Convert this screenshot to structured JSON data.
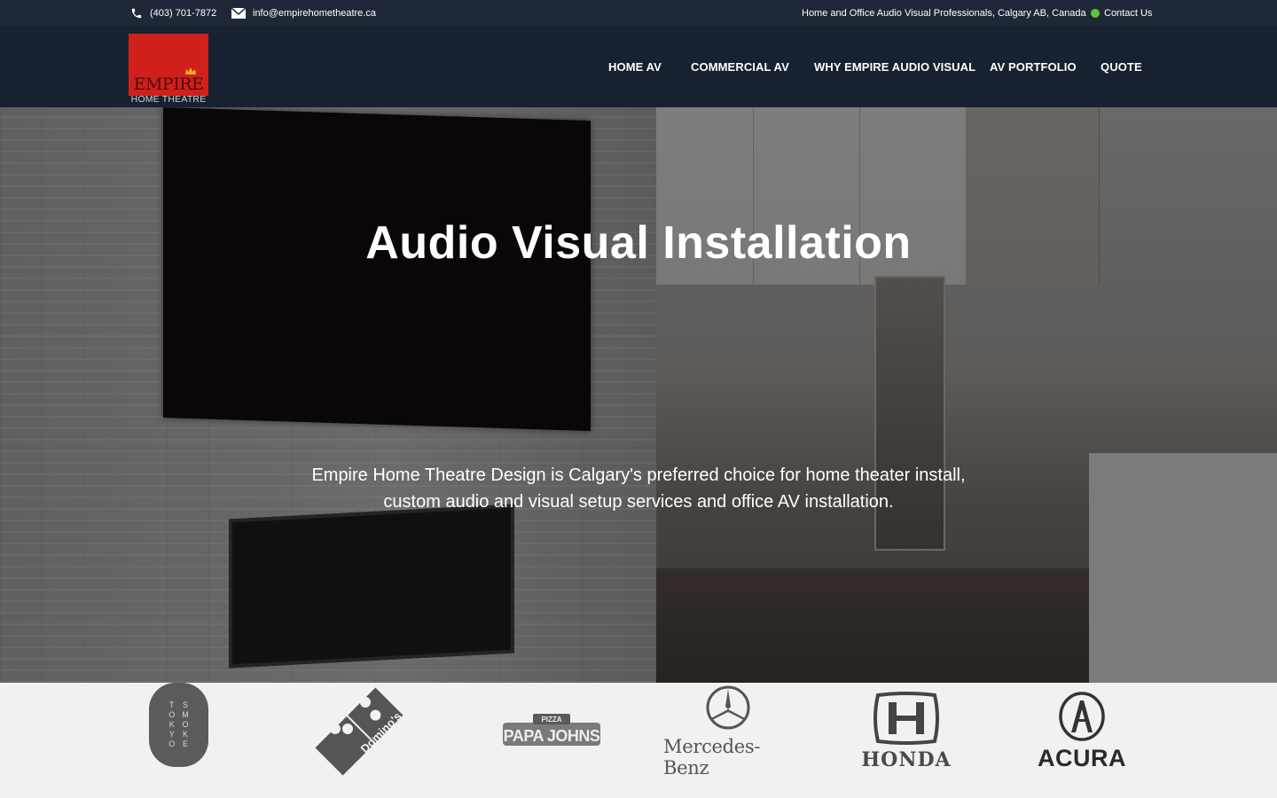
{
  "topbar": {
    "phone": "(403) 701-7872",
    "email": "info@empirehometheatre.ca",
    "tagline": "Home and Office Audio Visual Professionals, Calgary AB, Canada",
    "contact": "Contact Us",
    "contact_dot_color": "#5cc43b"
  },
  "logo": {
    "word": "EMPIRE",
    "sub": "HOME THEATRE",
    "brand_color": "#d0201c"
  },
  "nav": {
    "items": [
      {
        "label": "HOME AV"
      },
      {
        "label": "COMMERCIAL AV"
      },
      {
        "label": "WHY EMPIRE AUDIO VISUAL"
      },
      {
        "label": "AV PORTFOLIO"
      },
      {
        "label": "QUOTE"
      }
    ]
  },
  "hero": {
    "title": "Audio Visual Installation",
    "subtitle": "Empire Home Theatre Design is Calgary's preferred choice for home theater install, custom audio and visual setup services and office AV installation."
  },
  "clients": {
    "tokyo_left": [
      "T",
      "O",
      "K",
      "Y",
      "O"
    ],
    "tokyo_right": [
      "S",
      "M",
      "O",
      "K",
      "E"
    ],
    "dominos": "Domino's Pizza",
    "papa_top": "PIZZA",
    "papa": "PAPA JOHNS",
    "mercedes": "Mercedes-Benz",
    "honda": "HONDA",
    "acura": "ACURA"
  },
  "colors": {
    "topbar_bg": "#1f2838",
    "header_bg": "#182130",
    "strip_bg": "#f1f1f1"
  }
}
